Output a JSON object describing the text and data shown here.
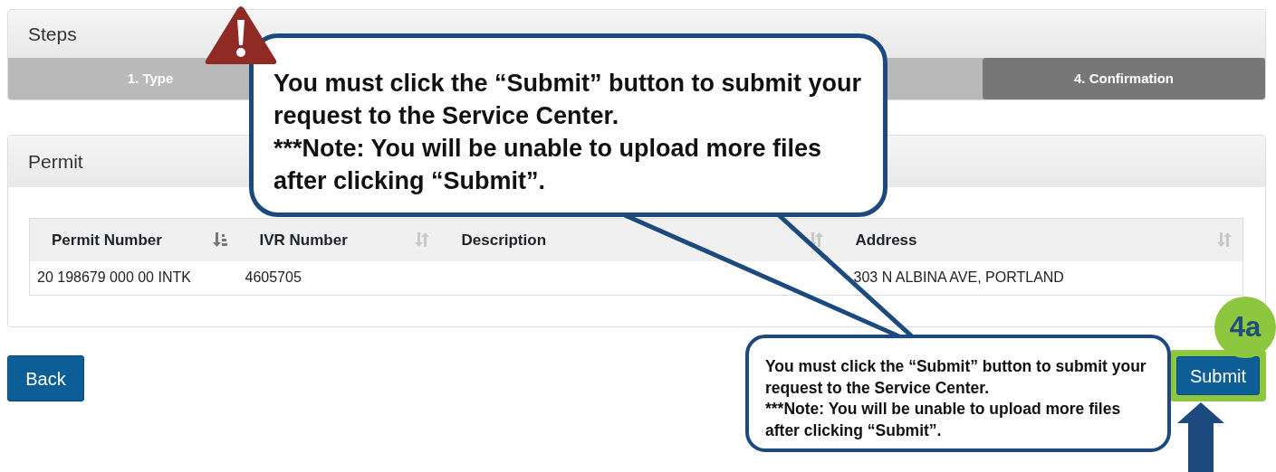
{
  "steps_panel": {
    "title": "Steps",
    "steps": [
      {
        "label": "1. Type",
        "selected": false
      },
      {
        "label": "4. Confirmation",
        "selected": true
      }
    ]
  },
  "permit_panel": {
    "title": "Permit",
    "table": {
      "columns": [
        {
          "label": "Permit Number",
          "sorted": true
        },
        {
          "label": "IVR Number",
          "sorted": false
        },
        {
          "label": "Description",
          "sorted": false
        },
        {
          "label": "Address",
          "sorted": false
        }
      ],
      "rows": [
        {
          "permit_number": "20 198679 000 00 INTK",
          "ivr_number": "4605705",
          "address": "303 N ALBINA AVE, PORTLAND"
        }
      ]
    }
  },
  "buttons": [
    {
      "label": "Back",
      "kind": "back",
      "highlighted": false
    },
    {
      "label": "Submit",
      "kind": "submit",
      "highlighted": true
    }
  ],
  "annotations": {
    "step_badge": "4a",
    "callouts": [
      {
        "warning": true,
        "paragraphs": [
          "You must click the “Submit” button to submit your request to the Service Center.",
          "***Note: You will be unable to upload more files after clicking “Submit”."
        ]
      },
      {
        "warning": false,
        "paragraphs": [
          "You must click the “Submit” button to submit your request to the Service Center.",
          "***Note: You will be unable to upload more files after clicking “Submit”."
        ]
      }
    ]
  }
}
